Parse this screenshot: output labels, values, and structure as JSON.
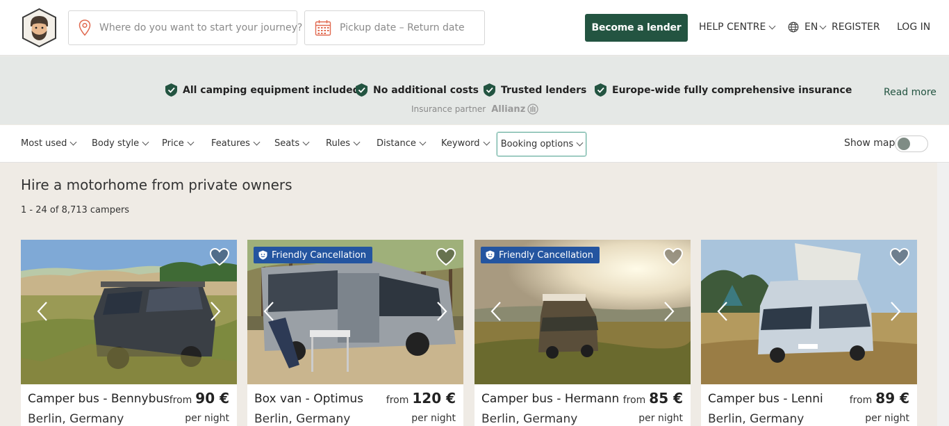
{
  "header": {
    "search_placeholder": "Where do you want to start your journey?",
    "date_placeholder": "Pickup date – Return date",
    "lender_button": "Become a lender",
    "help_centre": "HELP CENTRE",
    "language": "EN",
    "register": "REGISTER",
    "login": "LOG IN"
  },
  "benefits": {
    "items": [
      "All camping equipment included",
      "No additional costs",
      "Trusted lenders",
      "Europe-wide fully comprehensive insurance"
    ],
    "partner_label": "Insurance partner",
    "partner_name": "Allianz",
    "read_more": "Read more"
  },
  "filters": {
    "items": [
      "Most used",
      "Body style",
      "Price",
      "Features",
      "Seats",
      "Rules",
      "Distance",
      "Keyword"
    ],
    "active": "Booking options",
    "show_map": "Show map"
  },
  "main": {
    "title": "Hire a motorhome from private owners",
    "count": "1 - 24 of 8,713 campers"
  },
  "listings": [
    {
      "title": "Camper bus - Bennybus",
      "location": "Berlin, Germany",
      "from": "from",
      "price": "90 €",
      "per": "per night",
      "badge": ""
    },
    {
      "title": "Box van - Optimus",
      "location": "Berlin, Germany",
      "from": "from",
      "price": "120 €",
      "per": "per night",
      "badge": "Friendly Cancellation"
    },
    {
      "title": "Camper bus - Hermann",
      "location": "Berlin, Germany",
      "from": "from",
      "price": "85 €",
      "per": "per night",
      "badge": "Friendly Cancellation"
    },
    {
      "title": "Camper bus - Lenni",
      "location": "Berlin, Germany",
      "from": "from",
      "price": "89 €",
      "per": "per night",
      "badge": ""
    }
  ],
  "colors": {
    "brand_green": "#235441",
    "badge_blue": "#2455a0",
    "background": "#efebe5"
  }
}
